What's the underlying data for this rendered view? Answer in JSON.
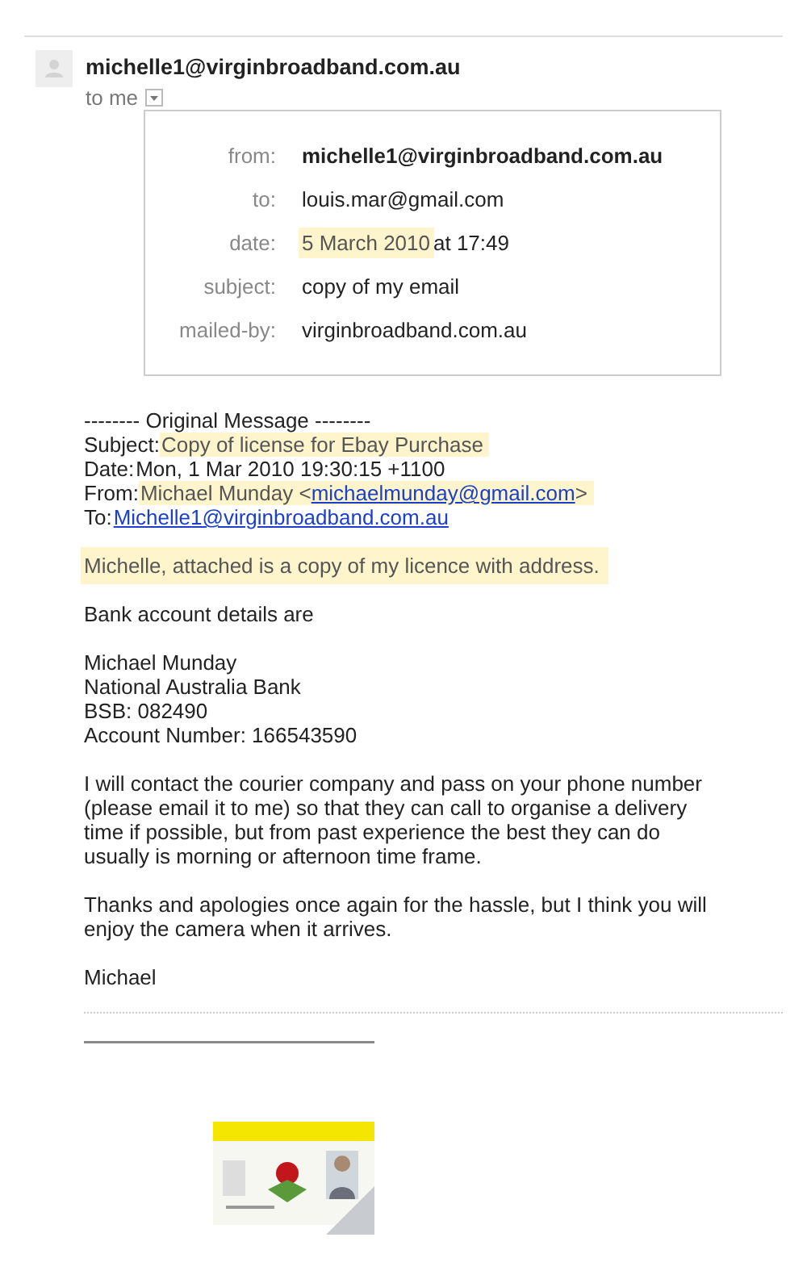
{
  "sender": {
    "address": "michelle1@virginbroadband.com.au",
    "recipient_summary": "to me"
  },
  "details": [
    {
      "label": "from:",
      "value": "michelle1@virginbroadband.com.au",
      "bold": true,
      "highlighted": false
    },
    {
      "label": "to:",
      "value": "louis.mar@gmail.com",
      "bold": false,
      "highlighted": false
    },
    {
      "label": "date:",
      "value": "5 March 2010",
      "suffix": "at 17:49",
      "bold": false,
      "highlighted": true
    },
    {
      "label": "subject:",
      "value": "copy of my email",
      "bold": false,
      "highlighted": false
    },
    {
      "label": "mailed-by:",
      "value": "virginbroadband.com.au",
      "bold": false,
      "highlighted": false
    }
  ],
  "original_message": {
    "heading": "-------- Original Message --------",
    "fields": [
      {
        "label": "Subject:",
        "value": "Copy of license for Ebay Purchase",
        "highlighted": true
      },
      {
        "label": "Date:",
        "value": "Mon, 1 Mar 2010 19:30:15 +1100",
        "highlighted": false
      },
      {
        "label": "From:",
        "value": "Michael Munday <",
        "link": "michaelmunday@gmail.com",
        "suffix": ">",
        "highlighted": true
      },
      {
        "label": "To:",
        "link": "Michelle1@virginbroadband.com.au",
        "highlighted": false
      }
    ]
  },
  "paragraphs": [
    {
      "lines": [
        "Michelle, attached is a copy of my licence with address."
      ],
      "highlighted": true
    },
    {
      "lines": [
        "Bank account details are"
      ],
      "highlighted": false
    },
    {
      "lines": [
        "Michael Munday",
        "National Australia Bank",
        "BSB: 082490",
        "Account Number: 166543590"
      ],
      "highlighted": false
    },
    {
      "lines": [
        "I will contact the courier company and pass on your phone number",
        "(please email it to me) so that they can call to organise a delivery",
        "time if possible, but from past experience the best they can do",
        "usually is morning or afternoon time frame."
      ],
      "highlighted": false
    },
    {
      "lines": [
        "Thanks and apologies once again for the hassle, but I think you will",
        "enjoy the camera when it arrives."
      ],
      "highlighted": false
    },
    {
      "lines": [
        "Michael"
      ],
      "highlighted": false
    }
  ]
}
